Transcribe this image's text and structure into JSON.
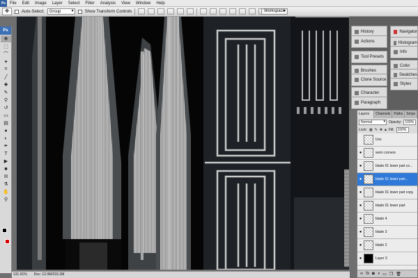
{
  "menu": [
    "File",
    "Edit",
    "Image",
    "Layer",
    "Select",
    "Filter",
    "Analysis",
    "View",
    "Window",
    "Help"
  ],
  "options": {
    "auto_select_label": "Auto-Select:",
    "auto_select_value": "Group",
    "show_transform_label": "Show Transform Controls",
    "workspace_label": "Workspace"
  },
  "toolbox": {
    "badge": "Ps"
  },
  "status": {
    "zoom": "131.91%",
    "doc": "Doc: 12.0M/315.3M"
  },
  "panels": {
    "history": "History",
    "actions": "Actions",
    "tool_presets": "Tool Presets",
    "brushes": "Brushes",
    "clone_source": "Clone Source",
    "character": "Character",
    "paragraph": "Paragraph",
    "navigator": "Navigator",
    "histogram": "Histogram",
    "info": "Info",
    "color": "Color",
    "swatches": "Swatches",
    "styles": "Styles"
  },
  "layers_panel": {
    "tabs": [
      "Layers ×",
      "Channels",
      "Paths",
      "Smps"
    ],
    "blend_mode": "Normal",
    "opacity_label": "Opacity:",
    "opacity_value": "100%",
    "lock_label": "Lock:",
    "fill_label": "Fill:",
    "fill_value": "100%",
    "layers": [
      {
        "name": "Uvs",
        "visible": false,
        "selected": false
      },
      {
        "name": "worn corners",
        "visible": true,
        "selected": false
      },
      {
        "name": "blade 01 lower part co...",
        "visible": true,
        "selected": false
      },
      {
        "name": "blade 01 lower part...",
        "visible": true,
        "selected": true
      },
      {
        "name": "blade 01 lower part copy",
        "visible": true,
        "selected": false
      },
      {
        "name": "blade 01 lower part",
        "visible": true,
        "selected": false
      },
      {
        "name": "blade 4",
        "visible": true,
        "selected": false
      },
      {
        "name": "blade 3",
        "visible": true,
        "selected": false
      },
      {
        "name": "blade 2",
        "visible": true,
        "selected": false
      },
      {
        "name": "Layer 3",
        "visible": true,
        "selected": false
      }
    ]
  },
  "colors": {
    "foreground": "#000000",
    "background": "#d40000",
    "selection": "#2f79d8"
  }
}
